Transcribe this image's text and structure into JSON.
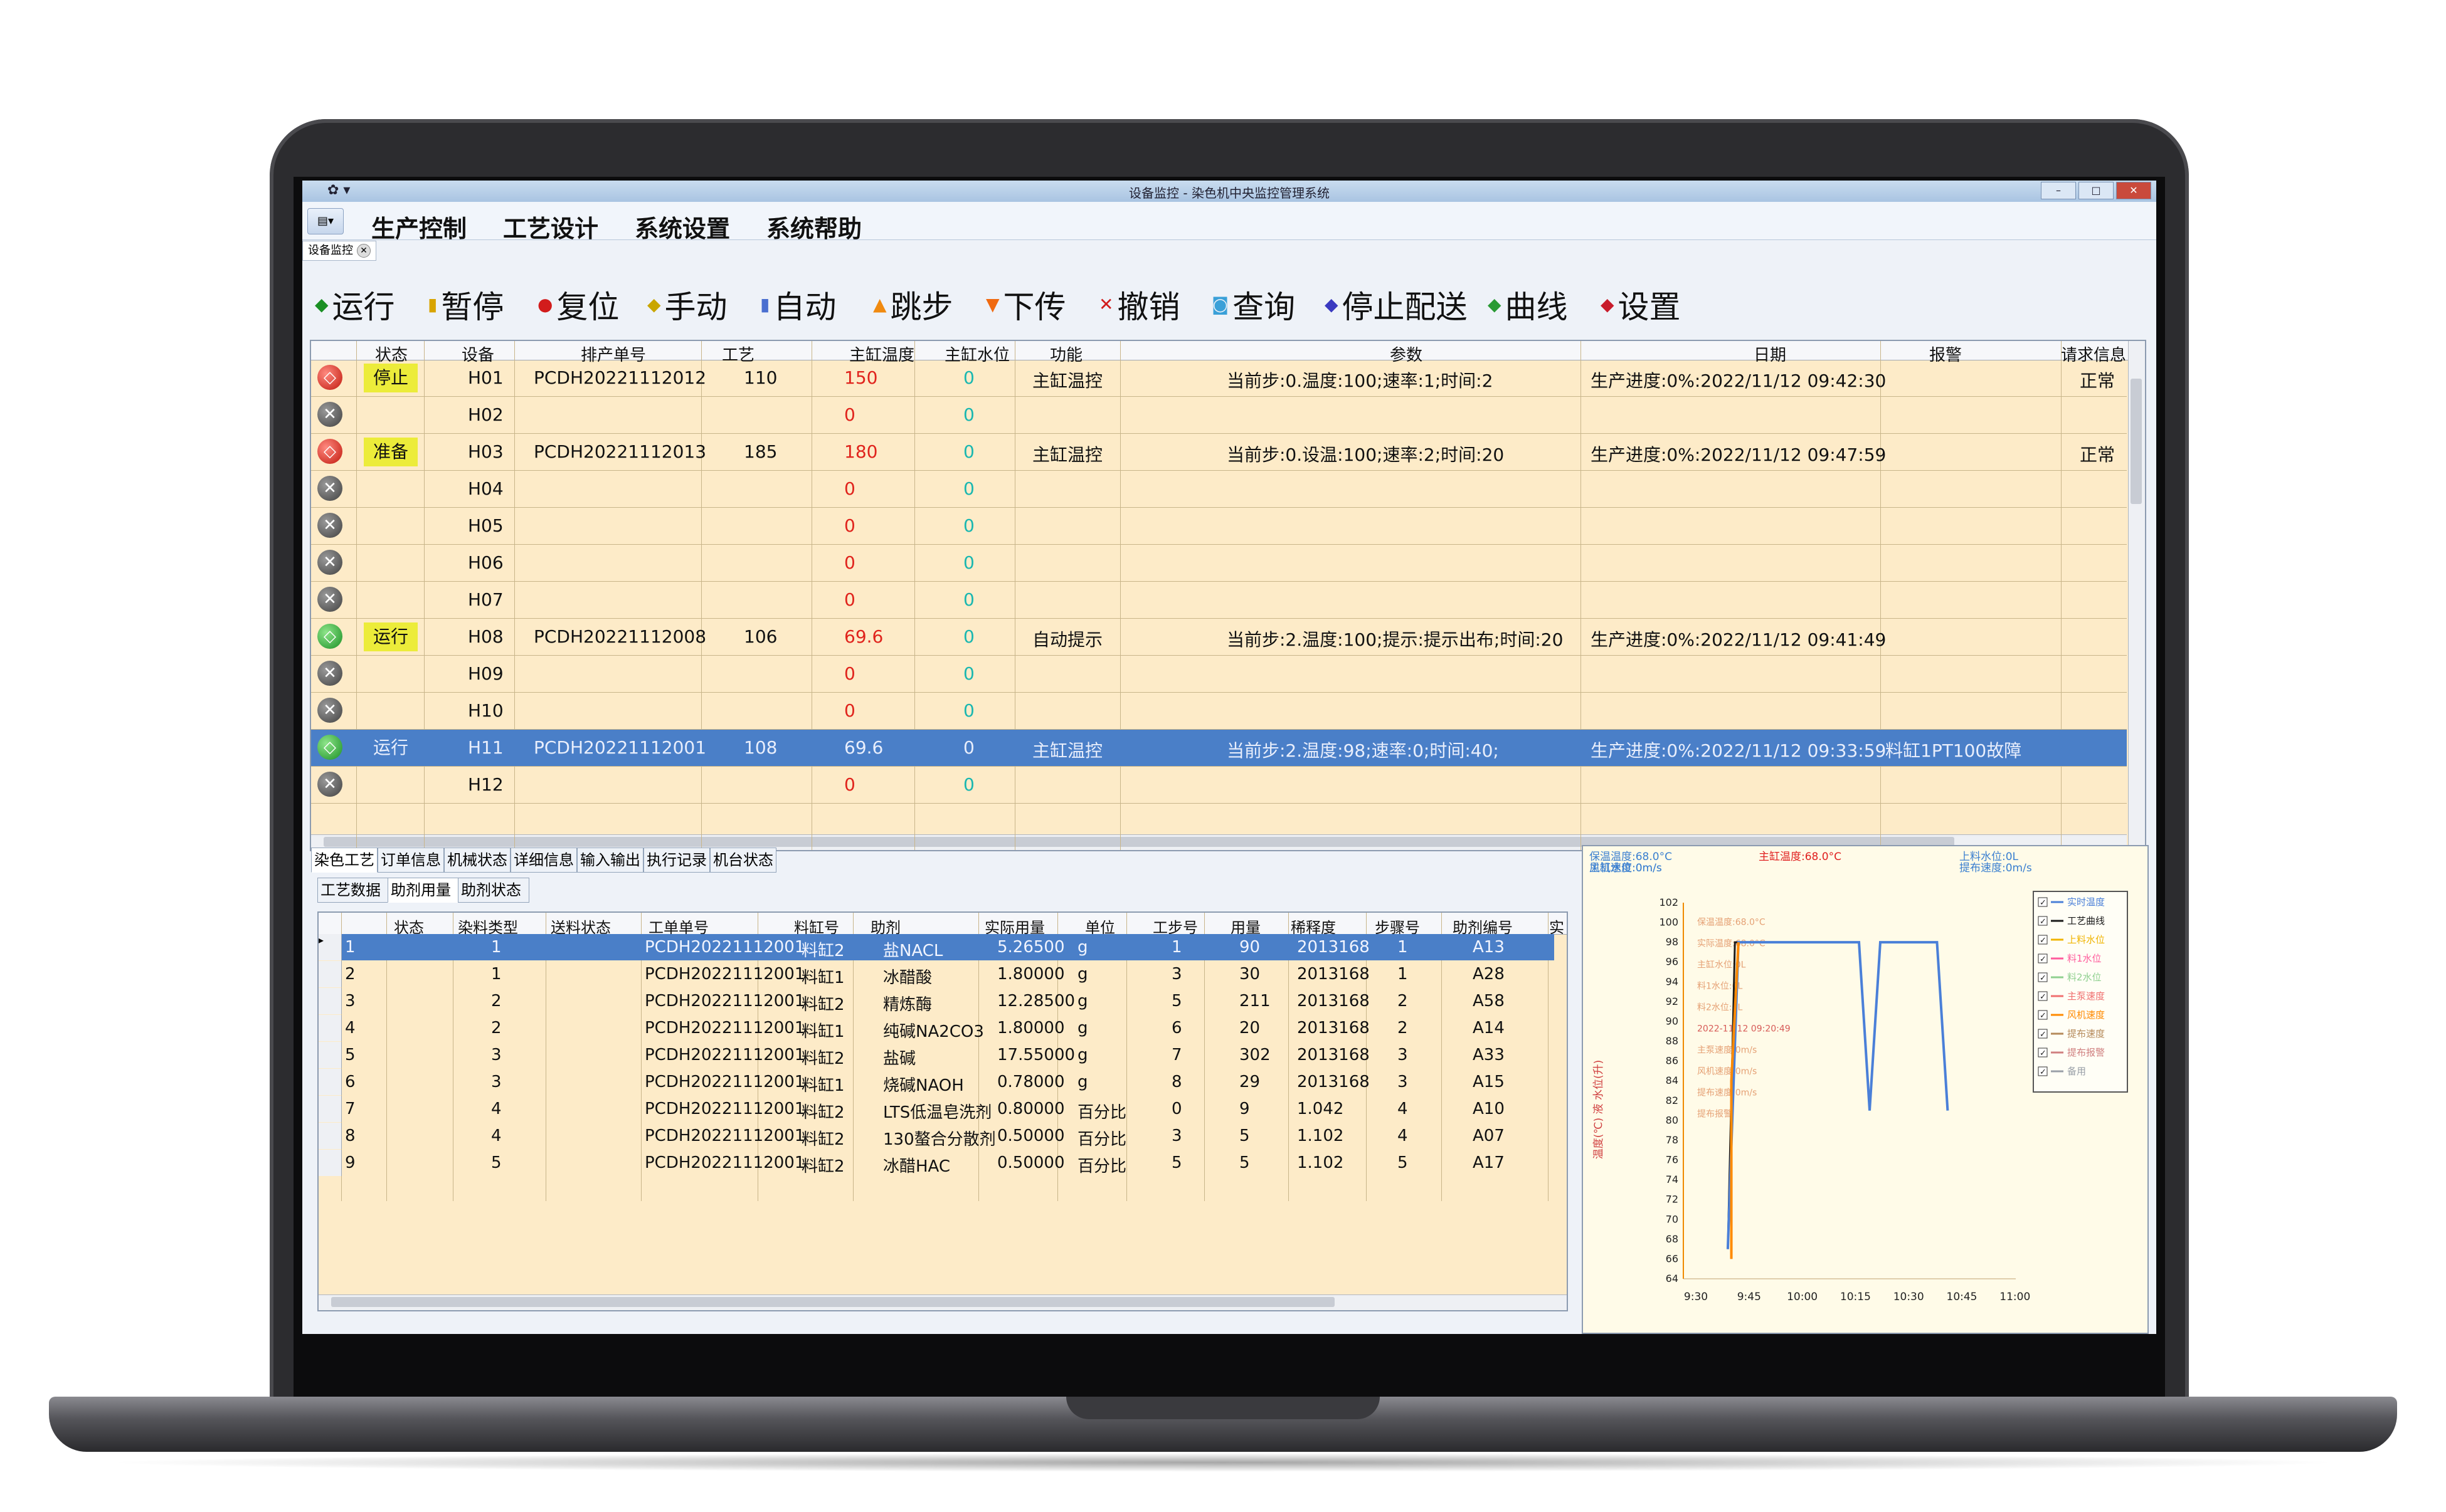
{
  "window": {
    "title": "设备监控 - 染色机中央监控管理系统",
    "quick_access": "✿ ▾"
  },
  "menu": [
    "生产控制",
    "工艺设计",
    "系统设置",
    "系统帮助"
  ],
  "doc_tab": "设备监控",
  "toolbar": [
    {
      "label": "运行",
      "icon": "run-icon",
      "color": "#1a8f24"
    },
    {
      "label": "暂停",
      "icon": "pause-icon",
      "color": "#d8a400"
    },
    {
      "label": "复位",
      "icon": "reset-icon",
      "color": "#d21c1c"
    },
    {
      "label": "手动",
      "icon": "hand-icon",
      "color": "#c9a600"
    },
    {
      "label": "自动",
      "icon": "auto-icon",
      "color": "#4a6fd0"
    },
    {
      "label": "跳步",
      "icon": "jump-up-icon",
      "color": "#f08a10"
    },
    {
      "label": "下传",
      "icon": "download-arrow-icon",
      "color": "#f06a10"
    },
    {
      "label": "撤销",
      "icon": "cancel-x-icon",
      "color": "#d21c1c"
    },
    {
      "label": "查询",
      "icon": "query-icon",
      "color": "#3aa0d8"
    },
    {
      "label": "停止配送",
      "icon": "stop-dispatch-icon",
      "color": "#3a3ac0"
    },
    {
      "label": "曲线",
      "icon": "curve-icon",
      "color": "#2a9a34"
    },
    {
      "label": "设置",
      "icon": "settings-icon",
      "color": "#c81c2c"
    }
  ],
  "machines": {
    "columns": [
      "状态",
      "设备",
      "排产单号",
      "工艺",
      "主缸温度",
      "主缸水位",
      "功能",
      "参数",
      "日期",
      "报警",
      "请求信息"
    ],
    "rows": [
      {
        "icon": "stop",
        "status": "停止",
        "device": "H01",
        "order": "PCDH20221112012",
        "craft": "110",
        "temp": "150",
        "level": "0",
        "func": "主缸温控",
        "param": "当前步:0.温度:100;速率:1;时间:2",
        "date": "生产进度:0%:2022/11/12 09:42:30",
        "alarm": "",
        "req": "正常",
        "selected": false
      },
      {
        "icon": "off",
        "status": "",
        "device": "H02",
        "order": "",
        "craft": "",
        "temp": "0",
        "level": "0",
        "func": "",
        "param": "",
        "date": "",
        "alarm": "",
        "req": "",
        "selected": false
      },
      {
        "icon": "stop",
        "status": "准备",
        "device": "H03",
        "order": "PCDH20221112013",
        "craft": "185",
        "temp": "180",
        "level": "0",
        "func": "主缸温控",
        "param": "当前步:0.设温:100;速率:2;时间:20",
        "date": "生产进度:0%:2022/11/12 09:47:59",
        "alarm": "",
        "req": "正常",
        "selected": false
      },
      {
        "icon": "off",
        "status": "",
        "device": "H04",
        "order": "",
        "craft": "",
        "temp": "0",
        "level": "0",
        "func": "",
        "param": "",
        "date": "",
        "alarm": "",
        "req": "",
        "selected": false
      },
      {
        "icon": "off",
        "status": "",
        "device": "H05",
        "order": "",
        "craft": "",
        "temp": "0",
        "level": "0",
        "func": "",
        "param": "",
        "date": "",
        "alarm": "",
        "req": "",
        "selected": false
      },
      {
        "icon": "off",
        "status": "",
        "device": "H06",
        "order": "",
        "craft": "",
        "temp": "0",
        "level": "0",
        "func": "",
        "param": "",
        "date": "",
        "alarm": "",
        "req": "",
        "selected": false
      },
      {
        "icon": "off",
        "status": "",
        "device": "H07",
        "order": "",
        "craft": "",
        "temp": "0",
        "level": "0",
        "func": "",
        "param": "",
        "date": "",
        "alarm": "",
        "req": "",
        "selected": false
      },
      {
        "icon": "run",
        "status": "运行",
        "device": "H08",
        "order": "PCDH20221112008",
        "craft": "106",
        "temp": "69.6",
        "level": "0",
        "func": "自动提示",
        "param": "当前步:2.温度:100;提示:提示出布;时间:20",
        "date": "生产进度:0%:2022/11/12 09:41:49",
        "alarm": "",
        "req": "",
        "selected": false
      },
      {
        "icon": "off",
        "status": "",
        "device": "H09",
        "order": "",
        "craft": "",
        "temp": "0",
        "level": "0",
        "func": "",
        "param": "",
        "date": "",
        "alarm": "",
        "req": "",
        "selected": false
      },
      {
        "icon": "off",
        "status": "",
        "device": "H10",
        "order": "",
        "craft": "",
        "temp": "0",
        "level": "0",
        "func": "",
        "param": "",
        "date": "",
        "alarm": "",
        "req": "",
        "selected": false
      },
      {
        "icon": "run",
        "status": "运行",
        "device": "H11",
        "order": "PCDH20221112001",
        "craft": "108",
        "temp": "69.6",
        "level": "0",
        "func": "主缸温控",
        "param": "当前步:2.温度:98;速率:0;时间:40;",
        "date": "生产进度:0%:2022/11/12 09:33:59",
        "alarm": "料缸1PT100故障",
        "req": "",
        "selected": true
      },
      {
        "icon": "off",
        "status": "",
        "device": "H12",
        "order": "",
        "craft": "",
        "temp": "0",
        "level": "0",
        "func": "",
        "param": "",
        "date": "",
        "alarm": "",
        "req": "",
        "selected": false
      }
    ]
  },
  "lower_tabs": [
    "染色工艺",
    "订单信息",
    "机械状态",
    "详细信息",
    "输入输出",
    "执行记录",
    "机台状态"
  ],
  "sub_tabs": [
    "工艺数据",
    "助剂用量",
    "助剂状态"
  ],
  "chemicals": {
    "columns": [
      "状态",
      "染料类型",
      "送料状态",
      "工单单号",
      "料缸号",
      "助剂",
      "实际用量",
      "单位",
      "工步号",
      "用量",
      "稀释度",
      "步骤号",
      "助剂编号",
      "实"
    ],
    "rows": [
      {
        "n": "1",
        "type": "1",
        "order": "PCDH20221112001",
        "tank": "料缸2",
        "agent": "盐NACL",
        "actual": "5.26500",
        "unit": "g",
        "step": "1",
        "amount": "90",
        "dilution": "2013168",
        "stepno": "1",
        "code": "A13",
        "selected": true
      },
      {
        "n": "2",
        "type": "1",
        "order": "PCDH20221112001",
        "tank": "料缸1",
        "agent": "冰醋酸",
        "actual": "1.80000",
        "unit": "g",
        "step": "3",
        "amount": "30",
        "dilution": "2013168",
        "stepno": "1",
        "code": "A28",
        "selected": false
      },
      {
        "n": "3",
        "type": "2",
        "order": "PCDH20221112001",
        "tank": "料缸2",
        "agent": "精炼酶",
        "actual": "12.28500",
        "unit": "g",
        "step": "5",
        "amount": "211",
        "dilution": "2013168",
        "stepno": "2",
        "code": "A58",
        "selected": false
      },
      {
        "n": "4",
        "type": "2",
        "order": "PCDH20221112001",
        "tank": "料缸1",
        "agent": "纯碱NA2CO3",
        "actual": "1.80000",
        "unit": "g",
        "step": "6",
        "amount": "20",
        "dilution": "2013168",
        "stepno": "2",
        "code": "A14",
        "selected": false
      },
      {
        "n": "5",
        "type": "3",
        "order": "PCDH20221112001",
        "tank": "料缸2",
        "agent": "盐碱",
        "actual": "17.55000",
        "unit": "g",
        "step": "7",
        "amount": "302",
        "dilution": "2013168",
        "stepno": "3",
        "code": "A33",
        "selected": false
      },
      {
        "n": "6",
        "type": "3",
        "order": "PCDH20221112001",
        "tank": "料缸1",
        "agent": "烧碱NAOH",
        "actual": "0.78000",
        "unit": "g",
        "step": "8",
        "amount": "29",
        "dilution": "2013168",
        "stepno": "3",
        "code": "A15",
        "selected": false
      },
      {
        "n": "7",
        "type": "4",
        "order": "PCDH20221112001",
        "tank": "料缸2",
        "agent": "LTS低温皂洗剂",
        "actual": "0.80000",
        "unit": "百分比",
        "step": "0",
        "amount": "9",
        "dilution": "1.042",
        "stepno": "4",
        "code": "A10",
        "selected": false
      },
      {
        "n": "8",
        "type": "4",
        "order": "PCDH20221112001",
        "tank": "料缸2",
        "agent": "130螯合分散剂",
        "actual": "0.50000",
        "unit": "百分比",
        "step": "3",
        "amount": "5",
        "dilution": "1.102",
        "stepno": "4",
        "code": "A07",
        "selected": false
      },
      {
        "n": "9",
        "type": "5",
        "order": "PCDH20221112001",
        "tank": "料缸2",
        "agent": "冰醋HAC",
        "actual": "0.50000",
        "unit": "百分比",
        "step": "5",
        "amount": "5",
        "dilution": "1.102",
        "stepno": "5",
        "code": "A17",
        "selected": false
      }
    ]
  },
  "chart_data": {
    "type": "line",
    "header": [
      "保温温度:68.0°C",
      "主缸温度:68.0°C",
      "上料水位:0L",
      "主缸水位:0m/s",
      "风机速度:0m/s",
      "提布速度:0m/s"
    ],
    "ylabel": "温度(℃) 液 水位(升)",
    "yticks": [
      64,
      66,
      68,
      70,
      72,
      74,
      76,
      78,
      80,
      82,
      84,
      86,
      88,
      90,
      92,
      94,
      96,
      98,
      100,
      102
    ],
    "ylim": [
      64,
      102
    ],
    "xticks": [
      "9:30",
      "9:45",
      "10:00",
      "10:15",
      "10:30",
      "10:45",
      "11:00"
    ],
    "x_minutes": [
      0,
      15,
      30,
      45,
      60,
      75,
      90
    ],
    "legend": [
      "实时温度",
      "工艺曲线",
      "上料水位",
      "料1水位",
      "料2水位",
      "主泵速度",
      "风机速度",
      "提布速度",
      "提布报警",
      "备用"
    ],
    "legend_colors": [
      "#4a7fd8",
      "#1a1a1a",
      "#f0b400",
      "#ff5c9c",
      "#8fd08f",
      "#f07070",
      "#ff8a00",
      "#b58a5a",
      "#d08080",
      "#9aa0a8"
    ],
    "inner_labels": [
      "保温温度:68.0°C",
      "实际温度:68.0°C",
      "主缸水位:0L",
      "料1水位:0L",
      "料2水位:0L",
      "2022-11-12 09:20:49",
      "主泵速度:0m/s",
      "风机速度:0m/s",
      "提布速度:0m/s",
      "提布报警"
    ],
    "series": [
      {
        "name": "工艺曲线",
        "color": "#1a1a1a",
        "points": [
          [
            9,
            67
          ],
          [
            11,
            98
          ],
          [
            42,
            98
          ]
        ]
      },
      {
        "name": "实时温度",
        "color": "#4a7fd8",
        "points": [
          [
            9,
            67
          ],
          [
            12,
            98
          ],
          [
            46,
            98
          ],
          [
            49,
            81
          ],
          [
            52,
            98
          ],
          [
            68,
            98
          ],
          [
            71,
            81
          ]
        ]
      },
      {
        "name": "上料水位",
        "color": "#ff8a00",
        "points": [
          [
            10,
            66
          ],
          [
            10,
            84
          ],
          [
            12,
            98
          ]
        ]
      }
    ]
  }
}
